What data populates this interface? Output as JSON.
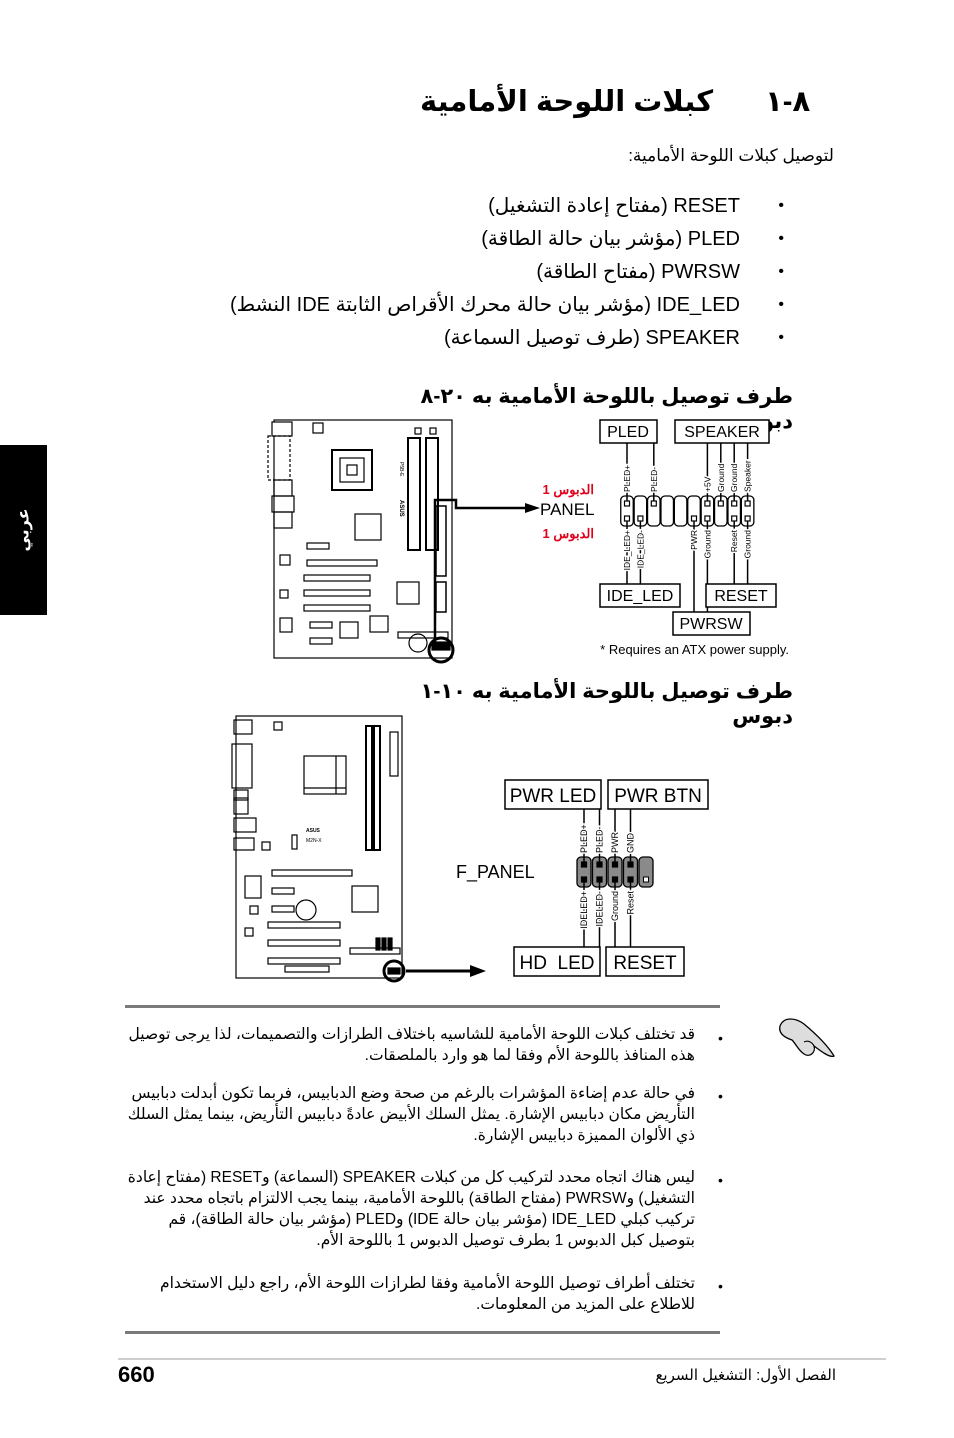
{
  "section": {
    "number": "٨-١",
    "title": "كبلات اللوحة الأمامية",
    "intro": "لتوصيل كبلات اللوحة الأمامية:"
  },
  "connector_list": [
    {
      "code": "RESET",
      "desc": "(مفتاح إعادة التشغيل)"
    },
    {
      "code": "PLED",
      "desc": "(مؤشر بيان حالة الطاقة)"
    },
    {
      "code": "PWRSW",
      "desc": "(مفتاح الطاقة)"
    },
    {
      "code": "IDE_LED",
      "desc": "(مؤشر بيان حالة محرك الأقراص الثابتة IDE النشط)"
    },
    {
      "code": "SPEAKER",
      "desc": "(طرف توصيل السماعة)"
    }
  ],
  "side_tab": "عربي",
  "figure1": {
    "caption": "طرف توصيل باللوحة الأمامية به ٢٠-٨ دبوس",
    "board_label": "P5B-E",
    "brand": "ASUS",
    "header_name": "PANEL",
    "pin1_label": "الدبوس 1",
    "groups_top": [
      "PLED",
      "SPEAKER"
    ],
    "groups_bottom": [
      "IDE_LED",
      "RESET"
    ],
    "group_below": "PWRSW",
    "top_pins": [
      "PLED+",
      "",
      "PLED-",
      "",
      "",
      "",
      "+5V",
      "Ground",
      "Ground",
      "Speaker"
    ],
    "bottom_pins": [
      "IDE_LED+",
      "IDE_LED-",
      "",
      "",
      "",
      "PWR",
      "Ground",
      "",
      "Reset",
      "Ground"
    ],
    "footnote": "* Requires an ATX power supply."
  },
  "figure2": {
    "caption": "طرف توصيل باللوحة الأمامية به ١٠-١ دبوس",
    "board_label": "M2N-X",
    "brand": "ASUS",
    "header_name": "F_PANEL",
    "groups_top": [
      "PWR LED",
      "PWR BTN"
    ],
    "groups_bottom": [
      "HD  LED",
      "RESET"
    ],
    "top_pins": [
      "PLED+",
      "PLED-",
      "PWR",
      "GND"
    ],
    "bottom_pins": [
      "IDELED+",
      "IDELED-",
      "Ground",
      "Reset"
    ]
  },
  "notes": [
    "قد تختلف كبلات اللوحة الأمامية للشاسيه باختلاف الطرازات والتصميمات، لذا يرجى توصيل هذه المنافذ باللوحة الأم وفقا لما هو وارد بالملصقات.",
    "في حالة عدم إضاءة المؤشرات بالرغم من صحة وضع الدبابيس، فربما تكون أبدلت دبابيس التأريض مكان دبابيس الإشارة. يمثل السلك الأبيض عادةً دبابيس التأريض، بينما يمثل السلك ذي الألوان المميزة دبابيس الإشارة.",
    "ليس هناك اتجاه محدد لتركيب كل من كبلات SPEAKER (السماعة) وRESET (مفتاح إعادة التشغيل) وPWRSW (مفتاح الطاقة) باللوحة الأمامية، بينما يجب الالتزام باتجاه محدد عند تركيب كبلي IDE_LED (مؤشر بيان حالة IDE) وPLED (مؤشر بيان حالة الطاقة)، قم بتوصيل كبل الدبوس 1 بطرف توصيل الدبوس 1 باللوحة الأم.",
    "تختلف أطراف توصيل اللوحة الأمامية وفقا لطرازات اللوحة الأم، راجع دليل الاستخدام للاطلاع على المزيد من المعلومات."
  ],
  "footer": {
    "page_number": "660",
    "chapter": "الفصل الأول: التشغيل السريع"
  },
  "colors": {
    "pin1_label": "#e0001b",
    "rule": "#7a7a7a",
    "side_tab_bg": "#000000",
    "header_fill_fig2": "#8a8a8a"
  }
}
